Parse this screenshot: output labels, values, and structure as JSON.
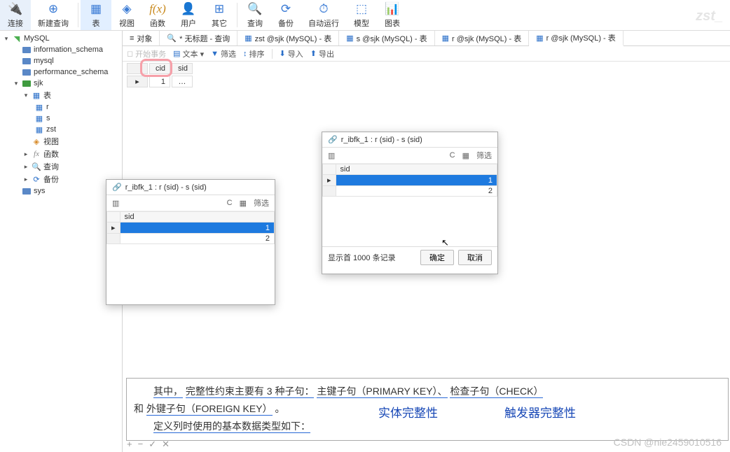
{
  "ribbon": [
    {
      "icon": "🔌",
      "label": "连接"
    },
    {
      "icon": "⊕",
      "label": "新建查询"
    },
    {
      "icon": "▦",
      "label": "表",
      "active": true
    },
    {
      "icon": "◈",
      "label": "视图"
    },
    {
      "icon": "f(x)",
      "label": "函数"
    },
    {
      "icon": "👤",
      "label": "用户"
    },
    {
      "icon": "⊞",
      "label": "其它"
    },
    {
      "icon": "🔍",
      "label": "查询"
    },
    {
      "icon": "⟳",
      "label": "备份"
    },
    {
      "icon": "⏱",
      "label": "自动运行"
    },
    {
      "icon": "⬚",
      "label": "模型"
    },
    {
      "icon": "📊",
      "label": "图表"
    }
  ],
  "watermark_top": "zst_",
  "tree": {
    "root": {
      "label": "MySQL"
    },
    "dbs": [
      "information_schema",
      "mysql",
      "performance_schema"
    ],
    "sjk": {
      "label": "sjk",
      "tables_folder": "表",
      "tables": [
        "r",
        "s",
        "zst"
      ],
      "views": "视图",
      "func": "函数",
      "query": "查询",
      "backup": "备份"
    },
    "sys": {
      "label": "sys"
    }
  },
  "tabs": [
    {
      "icon": "≡",
      "label": "对象"
    },
    {
      "icon": "🔍",
      "label": "* 无标题 - 查询"
    },
    {
      "icon": "▦",
      "label": "zst @sjk (MySQL) - 表"
    },
    {
      "icon": "▦",
      "label": "s @sjk (MySQL) - 表"
    },
    {
      "icon": "▦",
      "label": "r @sjk (MySQL) - 表"
    },
    {
      "icon": "▦",
      "label": "r @sjk (MySQL) - 表",
      "active": true
    }
  ],
  "subbar": {
    "begin": "开始事务",
    "text": "文本 ▾",
    "filter": "筛选",
    "sort": "排序",
    "import": "导入",
    "export": "导出"
  },
  "grid": {
    "cols": [
      "cid",
      "sid"
    ],
    "row": [
      "1",
      ""
    ],
    "ell": "…"
  },
  "panel_small": {
    "title": "r_ibfk_1 : r (sid) - s (sid)",
    "filter": "筛选",
    "col": "sid",
    "rows": [
      "1",
      "2"
    ]
  },
  "panel_big": {
    "title": "r_ibfk_1 : r (sid) - s (sid)",
    "filter": "筛选",
    "col": "sid",
    "rows": [
      "1",
      "2"
    ],
    "status": "显示首 1000 条记录",
    "ok": "确定",
    "cancel": "取消"
  },
  "notes": {
    "line1a": "其中，",
    "line1b": "完整性约束主要有 3 种子句：",
    "line1c": "主键子句（PRIMARY KEY）、",
    "line1d": "检查子句（CHECK）",
    "line2a": "和",
    "line2b": "外键子句（FOREIGN KEY）",
    "line2c": "。",
    "line3": "定义列时使用的基本数据类型如下：",
    "hand1": "实体完整性",
    "hand2": "触发器完整性"
  },
  "csdn": "CSDN @nie2459010516"
}
